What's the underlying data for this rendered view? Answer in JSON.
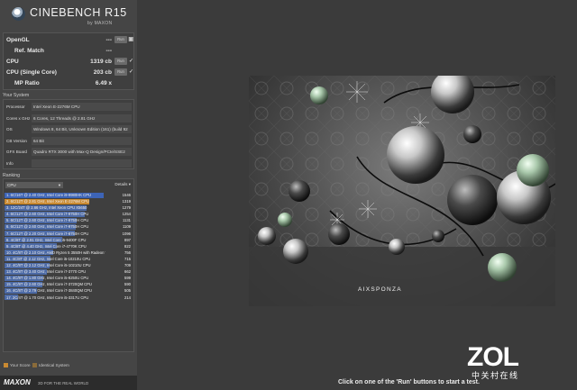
{
  "app": {
    "title": "CINEBENCH R15",
    "subtitle": "by MAXON"
  },
  "results": [
    {
      "label": "OpenGL",
      "value": "---",
      "button": "Run",
      "tick": "▣"
    },
    {
      "label": "Ref. Match",
      "value": "---",
      "button": "",
      "tick": ""
    },
    {
      "label": "CPU",
      "value": "1319 cb",
      "button": "Run",
      "tick": "✓"
    },
    {
      "label": "CPU (Single Core)",
      "value": "203 cb",
      "button": "Run",
      "tick": "✓"
    },
    {
      "label": "MP Ratio",
      "value": "6.49 x",
      "button": "",
      "tick": ""
    }
  ],
  "system": {
    "title": "Your System",
    "rows": [
      {
        "key": "Processor",
        "value": "Intel Xeon E-2276M CPU"
      },
      {
        "key": "Cores x GHz",
        "value": "6 Cores, 12 Threads @ 2.81 GHz"
      },
      {
        "key": "OS",
        "value": "Windows 8, 64 Bit, Unknown Edition (161) (build 92"
      },
      {
        "key": "CB Version",
        "value": "64 Bit"
      },
      {
        "key": "GFX Board",
        "value": "Quadro RTX 3000 with Max-Q Design/PCIe/SSE2"
      },
      {
        "key": "Info",
        "value": ""
      }
    ]
  },
  "ranking": {
    "title": "Ranking",
    "select_value": "CPU",
    "details_label": "Details",
    "max_score": 1546,
    "items": [
      {
        "text": "1. 6C/16T @ 2.40 GHz, Intel Core i9-9980HK CPU",
        "score": 1546,
        "kind": "ref"
      },
      {
        "text": "2. 6C/12T @ 2.81 GHz, Intel Xeon E-2276M CPU",
        "score": 1319,
        "kind": "mine"
      },
      {
        "text": "3. 12C/24T @ 2.66 GHz, Intel Xeon CPU X5650",
        "score": 1279,
        "kind": "other"
      },
      {
        "text": "4. 6C/12T @ 2.60 GHz, Intel Core i7-9750H CPU",
        "score": 1254,
        "kind": "other"
      },
      {
        "text": "5. 6C/12T @ 2.60 GHz, Intel Core i7-9750H CPU",
        "score": 1131,
        "kind": "other"
      },
      {
        "text": "6. 6C/12T @ 2.60 GHz, Intel Core i7-9750H CPU",
        "score": 1109,
        "kind": "other"
      },
      {
        "text": "7. 6C/12T @ 2.20 GHz, Intel Core i7-8750H CPU",
        "score": 1096,
        "kind": "other"
      },
      {
        "text": "8. 4C/8T @ 2.91 GHz, Intel Core i5-9400F CPU",
        "score": 897,
        "kind": "other"
      },
      {
        "text": "9. 4C/8T @ 4.40 GHz, Intel Core i7-4770K CPU",
        "score": 822,
        "kind": "other"
      },
      {
        "text": "10. 4C/8T @ 2.10 GHz, AMD Ryzen 5 3550H with Radeon Ve",
        "score": 756,
        "kind": "other"
      },
      {
        "text": "11. 4C/8T @ 2.12 GHz, Intel Core i5-10210U CPU",
        "score": 715,
        "kind": "other"
      },
      {
        "text": "12. 4C/8T @ 2.12 GHz, Intel Core i5-10210U CPU",
        "score": 709,
        "kind": "other"
      },
      {
        "text": "13. 4C/8T @ 3.40 GHz, Intel Core i7-3770 CPU",
        "score": 662,
        "kind": "other"
      },
      {
        "text": "14. 4C/8T @ 1.80 GHz, Intel Core i5-8250U CPU",
        "score": 599,
        "kind": "other"
      },
      {
        "text": "15. 4C/8T @ 2.60 GHz, Intel Core i7-3720QM CPU",
        "score": 590,
        "kind": "other"
      },
      {
        "text": "16. 4C/8T @ 2.79 GHz, Intel Core i7-3840QM CPU",
        "score": 505,
        "kind": "other"
      },
      {
        "text": "17. 2C/4T @ 1.70 GHz, Intel Core i5-3317U CPU",
        "score": 214,
        "kind": "other"
      }
    ]
  },
  "legend": {
    "your_score": "Your Score",
    "identical": "Identical System",
    "your_color": "#c98a32",
    "identical_color": "#8a6b3a"
  },
  "footer": {
    "maxon": "MAXON",
    "slogan": "3D FOR THE REAL WORLD"
  },
  "render": {
    "brand": "AIXSPONZA"
  },
  "watermark": {
    "logo": "ZOL",
    "sub": "中关村在线"
  },
  "status": "Click on one of the 'Run' buttons to start a test."
}
